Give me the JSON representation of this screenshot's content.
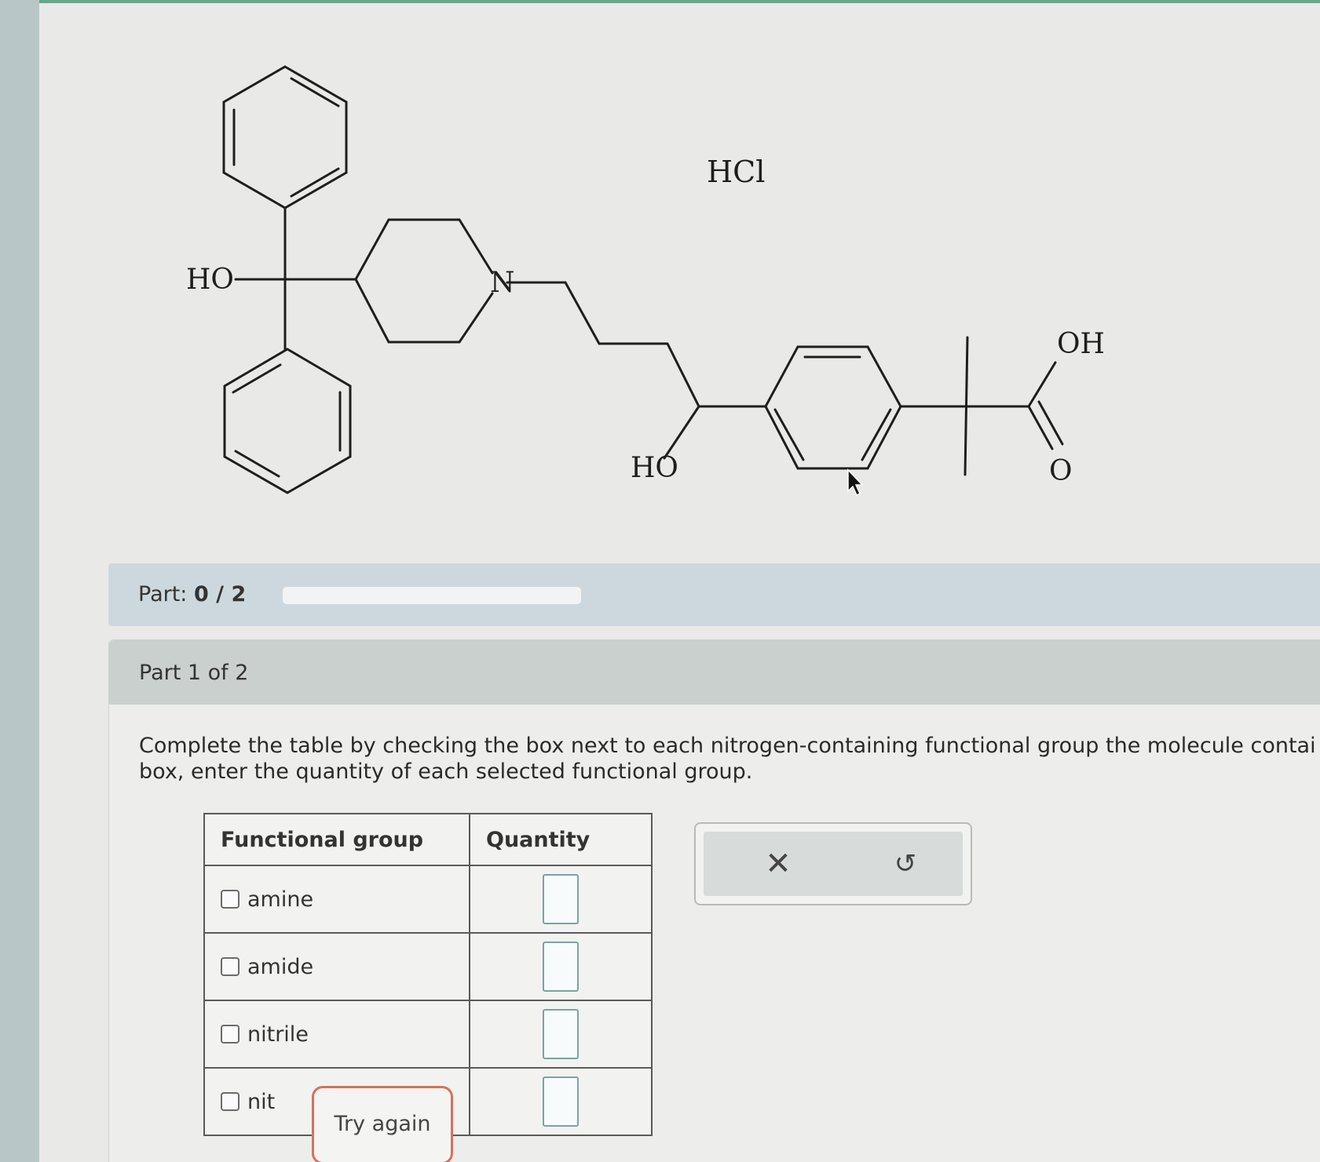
{
  "molecule": {
    "labels": {
      "hcl": "HCl",
      "ho_left": "HO",
      "n": "N",
      "ho_bottom": "HO",
      "oh": "OH",
      "o": "O"
    }
  },
  "progress": {
    "label": "Part:",
    "value": "0 / 2",
    "fraction": 0
  },
  "part": {
    "title": "Part 1 of 2",
    "question_line1": "Complete the table by checking the box next to each nitrogen-containing functional group the molecule contai",
    "question_line2": "box, enter the quantity of each selected functional group."
  },
  "table": {
    "headers": [
      "Functional group",
      "Quantity"
    ],
    "rows": [
      {
        "label": "amine",
        "checked": false,
        "quantity": ""
      },
      {
        "label": "amide",
        "checked": false,
        "quantity": ""
      },
      {
        "label": "nitrile",
        "checked": false,
        "quantity": ""
      },
      {
        "label": "nit",
        "checked": false,
        "quantity": ""
      }
    ]
  },
  "actions": {
    "clear_symbol": "✕",
    "undo_symbol": "↺"
  },
  "feedback": {
    "try_again_label": "Try again"
  }
}
